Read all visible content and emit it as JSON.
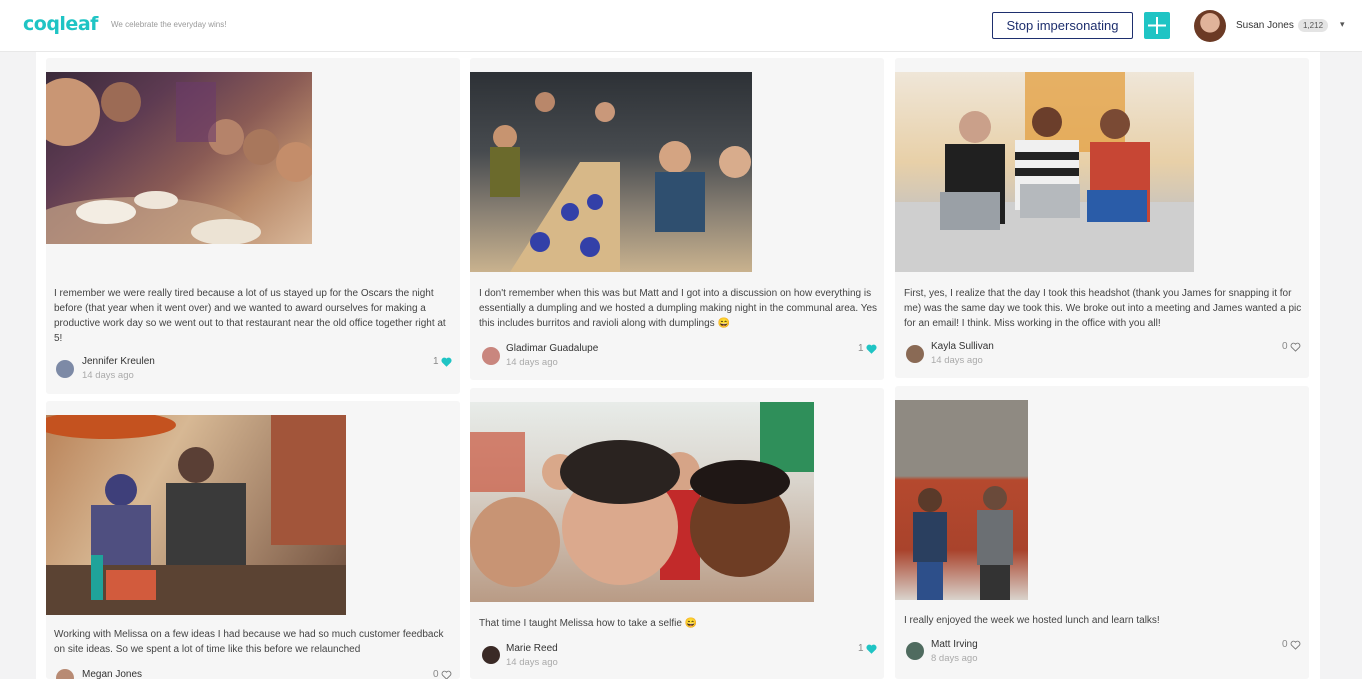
{
  "header": {
    "logo": "coqleaf",
    "tagline": "We celebrate the everyday wins!",
    "stop_impersonating_label": "Stop impersonating",
    "user_name": "Susan Jones",
    "points": "1,212"
  },
  "posts": [
    {
      "caption": "I remember we were really tired because a lot of us stayed up for the Oscars the night before (that year when it went over) and we wanted to award ourselves for making a productive work day so we went out to that restaurant near the old office together right at 5!",
      "author": "Jennifer Kreulen",
      "time": "14 days ago",
      "likes": "1",
      "liked": true
    },
    {
      "caption": "I don't remember when this was but Matt and I got into a discussion on how everything is essentially a dumpling and we hosted a dumpling making night in the communal area. Yes this includes burritos and ravioli along with dumplings 😄",
      "author": "Gladimar Guadalupe",
      "time": "14 days ago",
      "likes": "1",
      "liked": true
    },
    {
      "caption": "First, yes, I realize that the day I took this headshot (thank you James for snapping it for me) was the same day we took this. We broke out into a meeting and James wanted a pic for an email! I think. Miss working in the office with you all!",
      "author": "Kayla Sullivan",
      "time": "14 days ago",
      "likes": "0",
      "liked": false
    },
    {
      "caption": "Working with Melissa on a few ideas I had because we had so much customer feedback on site ideas. So we spent a lot of time like this before we relaunched",
      "author": "Megan Jones",
      "time": "",
      "likes": "0",
      "liked": false
    },
    {
      "caption": "That time I taught Melissa how to take a selfie 😄",
      "author": "Marie Reed",
      "time": "14 days ago",
      "likes": "1",
      "liked": true
    },
    {
      "caption": "I really enjoyed the week we hosted lunch and learn talks!",
      "author": "Matt Irving",
      "time": "8 days ago",
      "likes": "0",
      "liked": false
    }
  ],
  "colors": {
    "accent": "#1fc4c4",
    "navy": "#1e2f6e"
  }
}
